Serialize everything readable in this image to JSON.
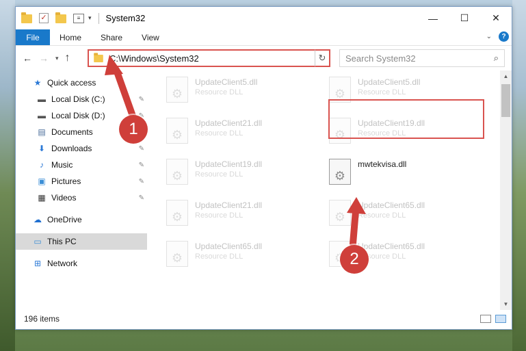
{
  "window": {
    "title": "System32",
    "controls": {
      "minimize": "—",
      "maximize": "☐",
      "close": "✕"
    }
  },
  "ribbon": {
    "file": "File",
    "tabs": [
      "Home",
      "Share",
      "View"
    ],
    "help": "?"
  },
  "navbar": {
    "back": "←",
    "forward": "→",
    "recent": "▾",
    "up": "↑",
    "address": "C:\\Windows\\System32",
    "refresh": "↻",
    "search_placeholder": "Search System32",
    "search_icon": "⌕"
  },
  "sidebar": {
    "items": [
      {
        "label": "Quick access",
        "icon": "star-icon",
        "glyph": "★",
        "color": "#2b79d6",
        "pinned": false
      },
      {
        "label": "Local Disk (C:)",
        "icon": "drive-icon",
        "glyph": "▬",
        "color": "#555555",
        "pinned": true
      },
      {
        "label": "Local Disk (D:)",
        "icon": "drive-icon",
        "glyph": "▬",
        "color": "#555555",
        "pinned": true
      },
      {
        "label": "Documents",
        "icon": "document-icon",
        "glyph": "▤",
        "color": "#4a6d9a",
        "pinned": true
      },
      {
        "label": "Downloads",
        "icon": "download-icon",
        "glyph": "⬇",
        "color": "#2b79d6",
        "pinned": true
      },
      {
        "label": "Music",
        "icon": "music-icon",
        "glyph": "♪",
        "color": "#2b79d6",
        "pinned": true
      },
      {
        "label": "Pictures",
        "icon": "pictures-icon",
        "glyph": "▣",
        "color": "#3b8ed6",
        "pinned": true
      },
      {
        "label": "Videos",
        "icon": "video-icon",
        "glyph": "▦",
        "color": "#333333",
        "pinned": true
      },
      {
        "label": "OneDrive",
        "icon": "cloud-icon",
        "glyph": "☁",
        "color": "#1f6fd0",
        "pinned": false
      },
      {
        "label": "This PC",
        "icon": "computer-icon",
        "glyph": "▭",
        "color": "#3b8ed6",
        "pinned": false
      },
      {
        "label": "Network",
        "icon": "network-icon",
        "glyph": "⊞",
        "color": "#2b79d6",
        "pinned": false
      }
    ],
    "pin_glyph": "📌"
  },
  "files": {
    "left": [
      {
        "name": "UpdateClient5.dll",
        "type": "Resource DLL"
      },
      {
        "name": "UpdateClient21.dll",
        "type": "Resource DLL"
      },
      {
        "name": "UpdateClient19.dll",
        "type": "Resource DLL"
      },
      {
        "name": "UpdateClient21.dll",
        "type": "Resource DLL"
      },
      {
        "name": "UpdateClient65.dll",
        "type": "Resource DLL"
      }
    ],
    "right": [
      {
        "name": "UpdateClient5.dll",
        "type": "Resource DLL"
      },
      {
        "name": "UpdateClient19.dll",
        "type": "Resource DLL"
      },
      {
        "name": "mwtekvisa.dll",
        "type": ""
      },
      {
        "name": "UpdateClient65.dll",
        "type": "Resource DLL"
      },
      {
        "name": "UpdateClient65.dll",
        "type": "Resource DLL"
      }
    ]
  },
  "status": {
    "items": "196 items"
  },
  "callouts": [
    "1",
    "2"
  ],
  "colors": {
    "accent": "#1979ca",
    "highlight": "#d9534f",
    "callout": "#cf3f3a"
  }
}
